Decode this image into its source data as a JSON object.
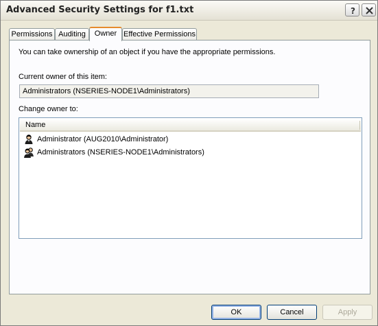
{
  "window": {
    "title": "Advanced Security Settings for f1.txt",
    "help_icon": "question-mark-icon",
    "close_icon": "close-x-icon"
  },
  "tabs": [
    {
      "label": "Permissions",
      "active": false
    },
    {
      "label": "Auditing",
      "active": false
    },
    {
      "label": "Owner",
      "active": true
    },
    {
      "label": "Effective Permissions",
      "active": false
    }
  ],
  "owner_tab": {
    "intro": "You can take ownership of an object if you have the appropriate permissions.",
    "current_owner_label": "Current owner of this item:",
    "current_owner_value": "Administrators (NSERIES-NODE1\\Administrators)",
    "change_owner_label": "Change owner to:",
    "list_header": "Name",
    "list_items": [
      {
        "name": "Administrator (AUG2010\\Administrator)",
        "icon": "user-icon"
      },
      {
        "name": "Administrators (NSERIES-NODE1\\Administrators)",
        "icon": "group-icon"
      }
    ]
  },
  "buttons": {
    "ok": "OK",
    "cancel": "Cancel",
    "apply": "Apply"
  }
}
